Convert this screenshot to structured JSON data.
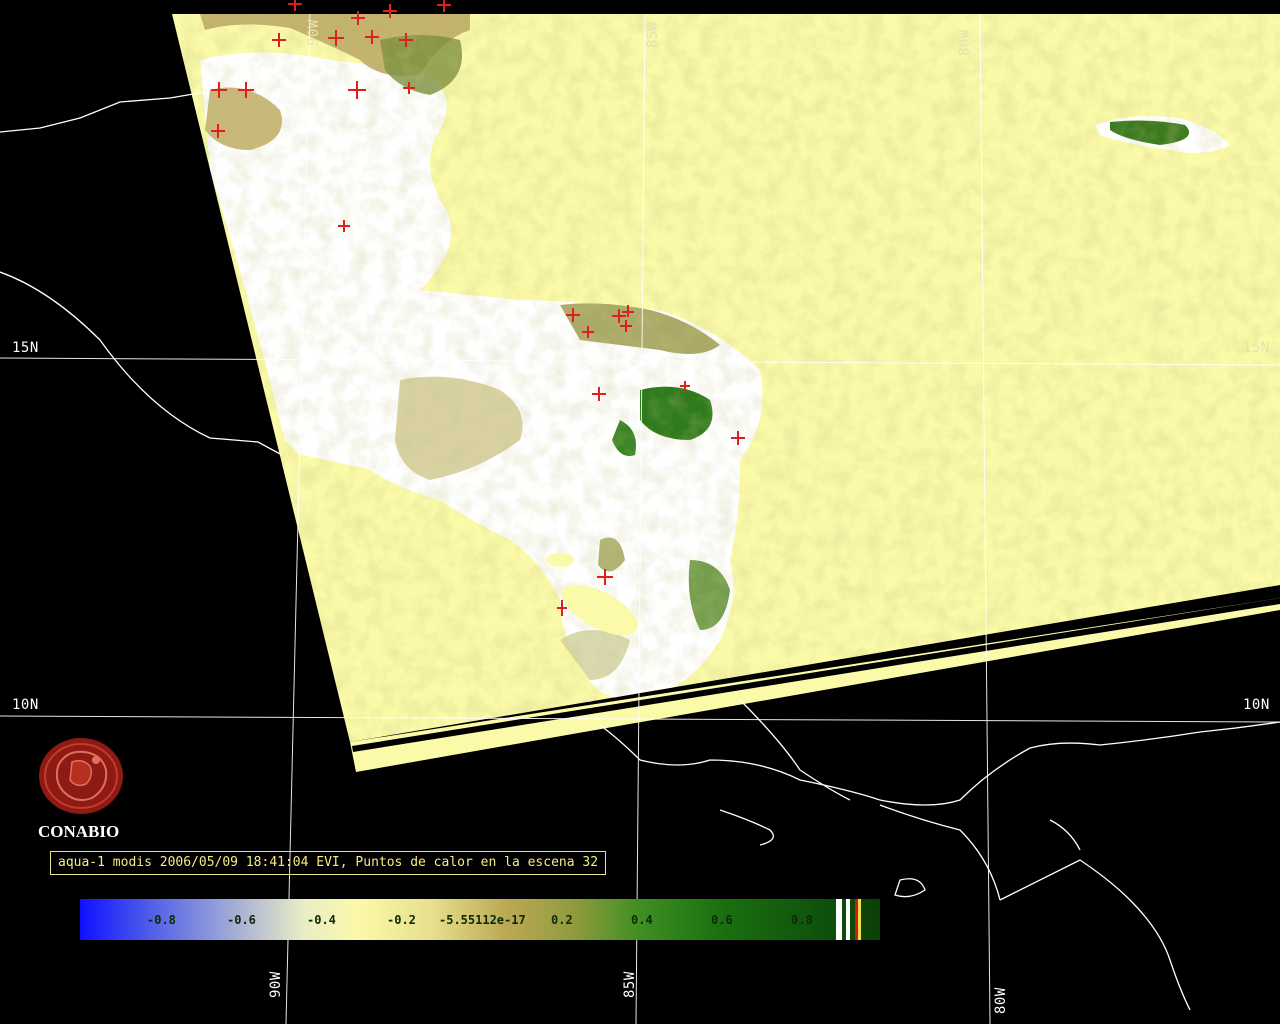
{
  "lat_labels": {
    "n15_left": "15N",
    "n15_right": "15N",
    "n10_left": "10N",
    "n10_right": "10N"
  },
  "lon_labels": {
    "w90_top": "90W",
    "w85_top": "85W",
    "w80_top": "80W",
    "w90_bottom": "90W",
    "w85_bottom": "85W",
    "w80_bottom": "80W"
  },
  "org_name": "CONABIO",
  "caption": "aqua-1 modis 2006/05/09 18:41:04 EVI, Puntos de calor en la escena 32",
  "colorbar": {
    "ticks": [
      "-0.8",
      "-0.6",
      "-0.4",
      "-0.2",
      "-5.55112e-17",
      "0.2",
      "0.4",
      "0.6",
      "0.8"
    ],
    "colors": {
      "low": "#1010ff",
      "mid": "#fbf9a8",
      "high": "#0d3f08"
    }
  },
  "colors": {
    "ocean_swath": "#fbfaa8",
    "background": "#000000",
    "coastline": "#ffffff",
    "hotspot": "#e02020",
    "vegetation": "#3b7a1e",
    "cloud": "#ffffff",
    "logo": "#8e1a14"
  },
  "icons": {
    "logo": "conabio-logo-icon",
    "hotspot": "plus-marker-icon"
  }
}
